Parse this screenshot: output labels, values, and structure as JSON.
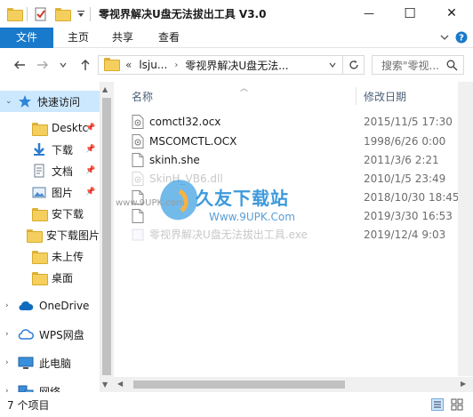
{
  "window": {
    "title": "零视界解决U盘无法拔出工具 V3.0",
    "minimize_glyph": "—",
    "maximize_glyph": "☐",
    "close_glyph": "✕"
  },
  "ribbon": {
    "tabs": [
      "文件",
      "主页",
      "共享",
      "查看"
    ]
  },
  "nav": {
    "breadcrumb_overflow": "«",
    "breadcrumb": [
      "lsju...",
      "零视界解决U盘无法..."
    ],
    "search_placeholder": "搜索\"零视..."
  },
  "sidebar": {
    "items": [
      {
        "label": "快速访问",
        "icon": "star-icon",
        "pinned": false,
        "selected": true
      },
      {
        "label": "Desktc",
        "icon": "folder-icon",
        "pinned": true,
        "selected": false
      },
      {
        "label": "下载",
        "icon": "download-arrow-icon",
        "pinned": true,
        "selected": false
      },
      {
        "label": "文档",
        "icon": "document-icon",
        "pinned": true,
        "selected": false
      },
      {
        "label": "图片",
        "icon": "pictures-icon",
        "pinned": true,
        "selected": false
      },
      {
        "label": "安下载",
        "icon": "folder-icon",
        "pinned": false,
        "selected": false
      },
      {
        "label": "安下载图片",
        "icon": "folder-icon",
        "pinned": false,
        "selected": false
      },
      {
        "label": "未上传",
        "icon": "folder-icon",
        "pinned": false,
        "selected": false
      },
      {
        "label": "桌面",
        "icon": "folder-icon",
        "pinned": false,
        "selected": false
      },
      {
        "label": "OneDrive",
        "icon": "cloud-icon",
        "pinned": false,
        "selected": false
      },
      {
        "label": "WPS网盘",
        "icon": "wps-cloud-icon",
        "pinned": false,
        "selected": false
      },
      {
        "label": "此电脑",
        "icon": "computer-icon",
        "pinned": false,
        "selected": false
      },
      {
        "label": "网络",
        "icon": "network-icon",
        "pinned": false,
        "selected": false
      }
    ]
  },
  "columns": {
    "name": "名称",
    "modified": "修改日期"
  },
  "files": [
    {
      "name": "comctl32.ocx",
      "date": "2015/11/5 17:30",
      "icon": "ocx-file-icon",
      "faded": false
    },
    {
      "name": "MSCOMCTL.OCX",
      "date": "1998/6/26 0:00",
      "icon": "ocx-file-icon",
      "faded": false
    },
    {
      "name": "skinh.she",
      "date": "2011/3/6 2:21",
      "icon": "blank-file-icon",
      "faded": false
    },
    {
      "name": "SkinH_VB6.dll",
      "date": "2010/1/5 23:49",
      "icon": "dll-file-icon",
      "faded": true
    },
    {
      "name": "",
      "date": "2018/10/30 18:45",
      "icon": "file-icon",
      "faded": false
    },
    {
      "name": "",
      "date": "2019/3/30 16:53",
      "icon": "file-icon",
      "faded": false
    },
    {
      "name": "零视界解决U盘无法拔出工具.exe",
      "date": "2019/12/4 9:03",
      "icon": "exe-file-icon",
      "faded": true
    }
  ],
  "watermark": {
    "brand": "久友下载站",
    "url_small": "www.9UPK.com",
    "url_large": "Www.9UPK.Com"
  },
  "status": {
    "item_count": "7 个项目"
  },
  "colors": {
    "accent": "#1979ca",
    "selection": "#cce8ff",
    "header_text": "#4c607a"
  }
}
